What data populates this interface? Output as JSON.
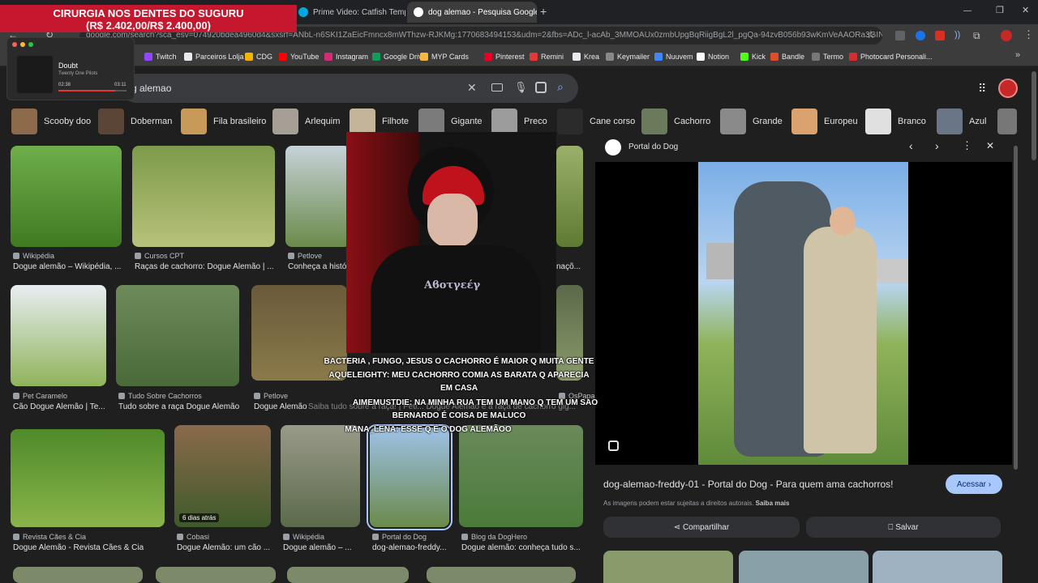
{
  "stream_overlay": {
    "donation_title": "CIRURGIA NOS DENTES DO SUGURU",
    "donation_amount": "(R$ 2.402,00/R$ 2.400,00)",
    "player_song": "Doubt",
    "player_artist": "Twenty One Pilots",
    "player_elapsed": "02:38",
    "player_total": "03:11",
    "player_progress": 0.83,
    "chat": [
      "BACTERIA , FUNGO, JESUS O CACHORRO É MAIOR Q MUITA GENTE",
      "AQUELEIGHTY: MEU CACHORRO COMIA AS BARATA Q APARECIA",
      "EM CASA",
      "AIMEMUSTDIE: NA MINHA RUA TEM UM MANO Q TEM UM SAO",
      "BERNARDO É COISA DE MALUCO",
      "MANA_LENA: ESSE Q É O DOG ALEMÃOO"
    ],
    "shirt_text": "Αϐοτγεέγ"
  },
  "browser": {
    "tabs": [
      {
        "label": "Prime Video: Catfish Temporada",
        "active": false
      },
      {
        "label": "dog alemao - Pesquisa Google",
        "active": true
      }
    ],
    "url": "google.com/search?sca_esv=074920bdea4960d4&sxsrf=ANbL-n6SKI1ZaEicFmncx8mWThzw-RJKMg:1770683494153&udm=2&fbs=ADc_l-acAb_3MMOAUx0zmbUpgBqRiigBgL2l_pgQa-94zvB056b93wKmVeAAORa3GINFZT67RHmD...",
    "bookmarks": [
      {
        "label": "Twitch",
        "color": "#9146ff"
      },
      {
        "label": "Parceiros Lolja",
        "color": "#e8eaed"
      },
      {
        "label": "CDG",
        "color": "#f4b400"
      },
      {
        "label": "YouTube",
        "color": "#ff0000"
      },
      {
        "label": "Instagram",
        "color": "#d62976"
      },
      {
        "label": "Google Drive",
        "color": "#0f9d58"
      },
      {
        "label": "MYP Cards",
        "color": "#f6b73c"
      },
      {
        "label": "Pinterest",
        "color": "#e60023"
      },
      {
        "label": "Remini",
        "color": "#e53935"
      },
      {
        "label": "Krea",
        "color": "#e8eaed"
      },
      {
        "label": "Keymailer",
        "color": "#888888"
      },
      {
        "label": "Nuuvem",
        "color": "#4285f4"
      },
      {
        "label": "Notion",
        "color": "#ffffff"
      },
      {
        "label": "Kick",
        "color": "#53fc18"
      },
      {
        "label": "Bandle",
        "color": "#e34c26"
      },
      {
        "label": "Termo",
        "color": "#777777"
      },
      {
        "label": "Photocard Personali...",
        "color": "#d32f2f"
      }
    ]
  },
  "search": {
    "query": "g alemao",
    "chips": [
      "Scooby doo",
      "Doberman",
      "Fila brasileiro",
      "Arlequim",
      "Filhote",
      "Gigante",
      "Preco",
      "Cane corso",
      "Cachorro",
      "Grande",
      "Europeu",
      "Branco",
      "Azul"
    ]
  },
  "results": [
    {
      "source": "Wikipédia",
      "title": "Dogue alemão – Wikipédia, ...",
      "badge": ""
    },
    {
      "source": "Cursos CPT",
      "title": "Raças de cachorro: Dogue Alemão | ...",
      "badge": ""
    },
    {
      "source": "Petlove",
      "title": "Conheça a histór",
      "badge": ""
    },
    {
      "source": "",
      "title": "naçõ...",
      "badge": ""
    },
    {
      "source": "Pet Caramelo",
      "title": "Cão Dogue Alemão | Te...",
      "badge": ""
    },
    {
      "source": "Tudo Sobre Cachorros",
      "title": "Tudo sobre a raça Dogue Alemão",
      "badge": ""
    },
    {
      "source": "Petlove",
      "title": "Dogue Alemão",
      "badge": ""
    },
    {
      "source": "OsPaparazzi",
      "title": "Saiba tudo sobre a raça! | Petl...   Dogue Alemão é a raça de cachorro gig...",
      "badge": ""
    },
    {
      "source": "Revista Cães & Cia",
      "title": "Dogue Alemão - Revista Cães & Cia",
      "badge": ""
    },
    {
      "source": "Cobasi",
      "title": "Dogue Alemão: um cão ...",
      "badge": "6 dias atrás"
    },
    {
      "source": "Wikipédia",
      "title": "Dogue alemão – ...",
      "badge": ""
    },
    {
      "source": "Portal do Dog",
      "title": "dog-alemao-freddy...",
      "badge": ""
    },
    {
      "source": "Blog da DogHero",
      "title": "Dogue alemão: conheça tudo s...",
      "badge": ""
    }
  ],
  "panel": {
    "site": "Portal do Dog",
    "title": "dog-alemao-freddy-01 - Portal do Dog - Para quem ama cachorros!",
    "visit_label": "Acessar",
    "copyright_text": "As imagens podem estar sujeitas a direitos autorais.",
    "learn_more": "Saiba mais",
    "share_label": "Compartilhar",
    "save_label": "Salvar"
  },
  "colors": {
    "accent": "#a8c7fa",
    "donation": "#c5172e",
    "panel_bg": "#1f1f1f"
  }
}
